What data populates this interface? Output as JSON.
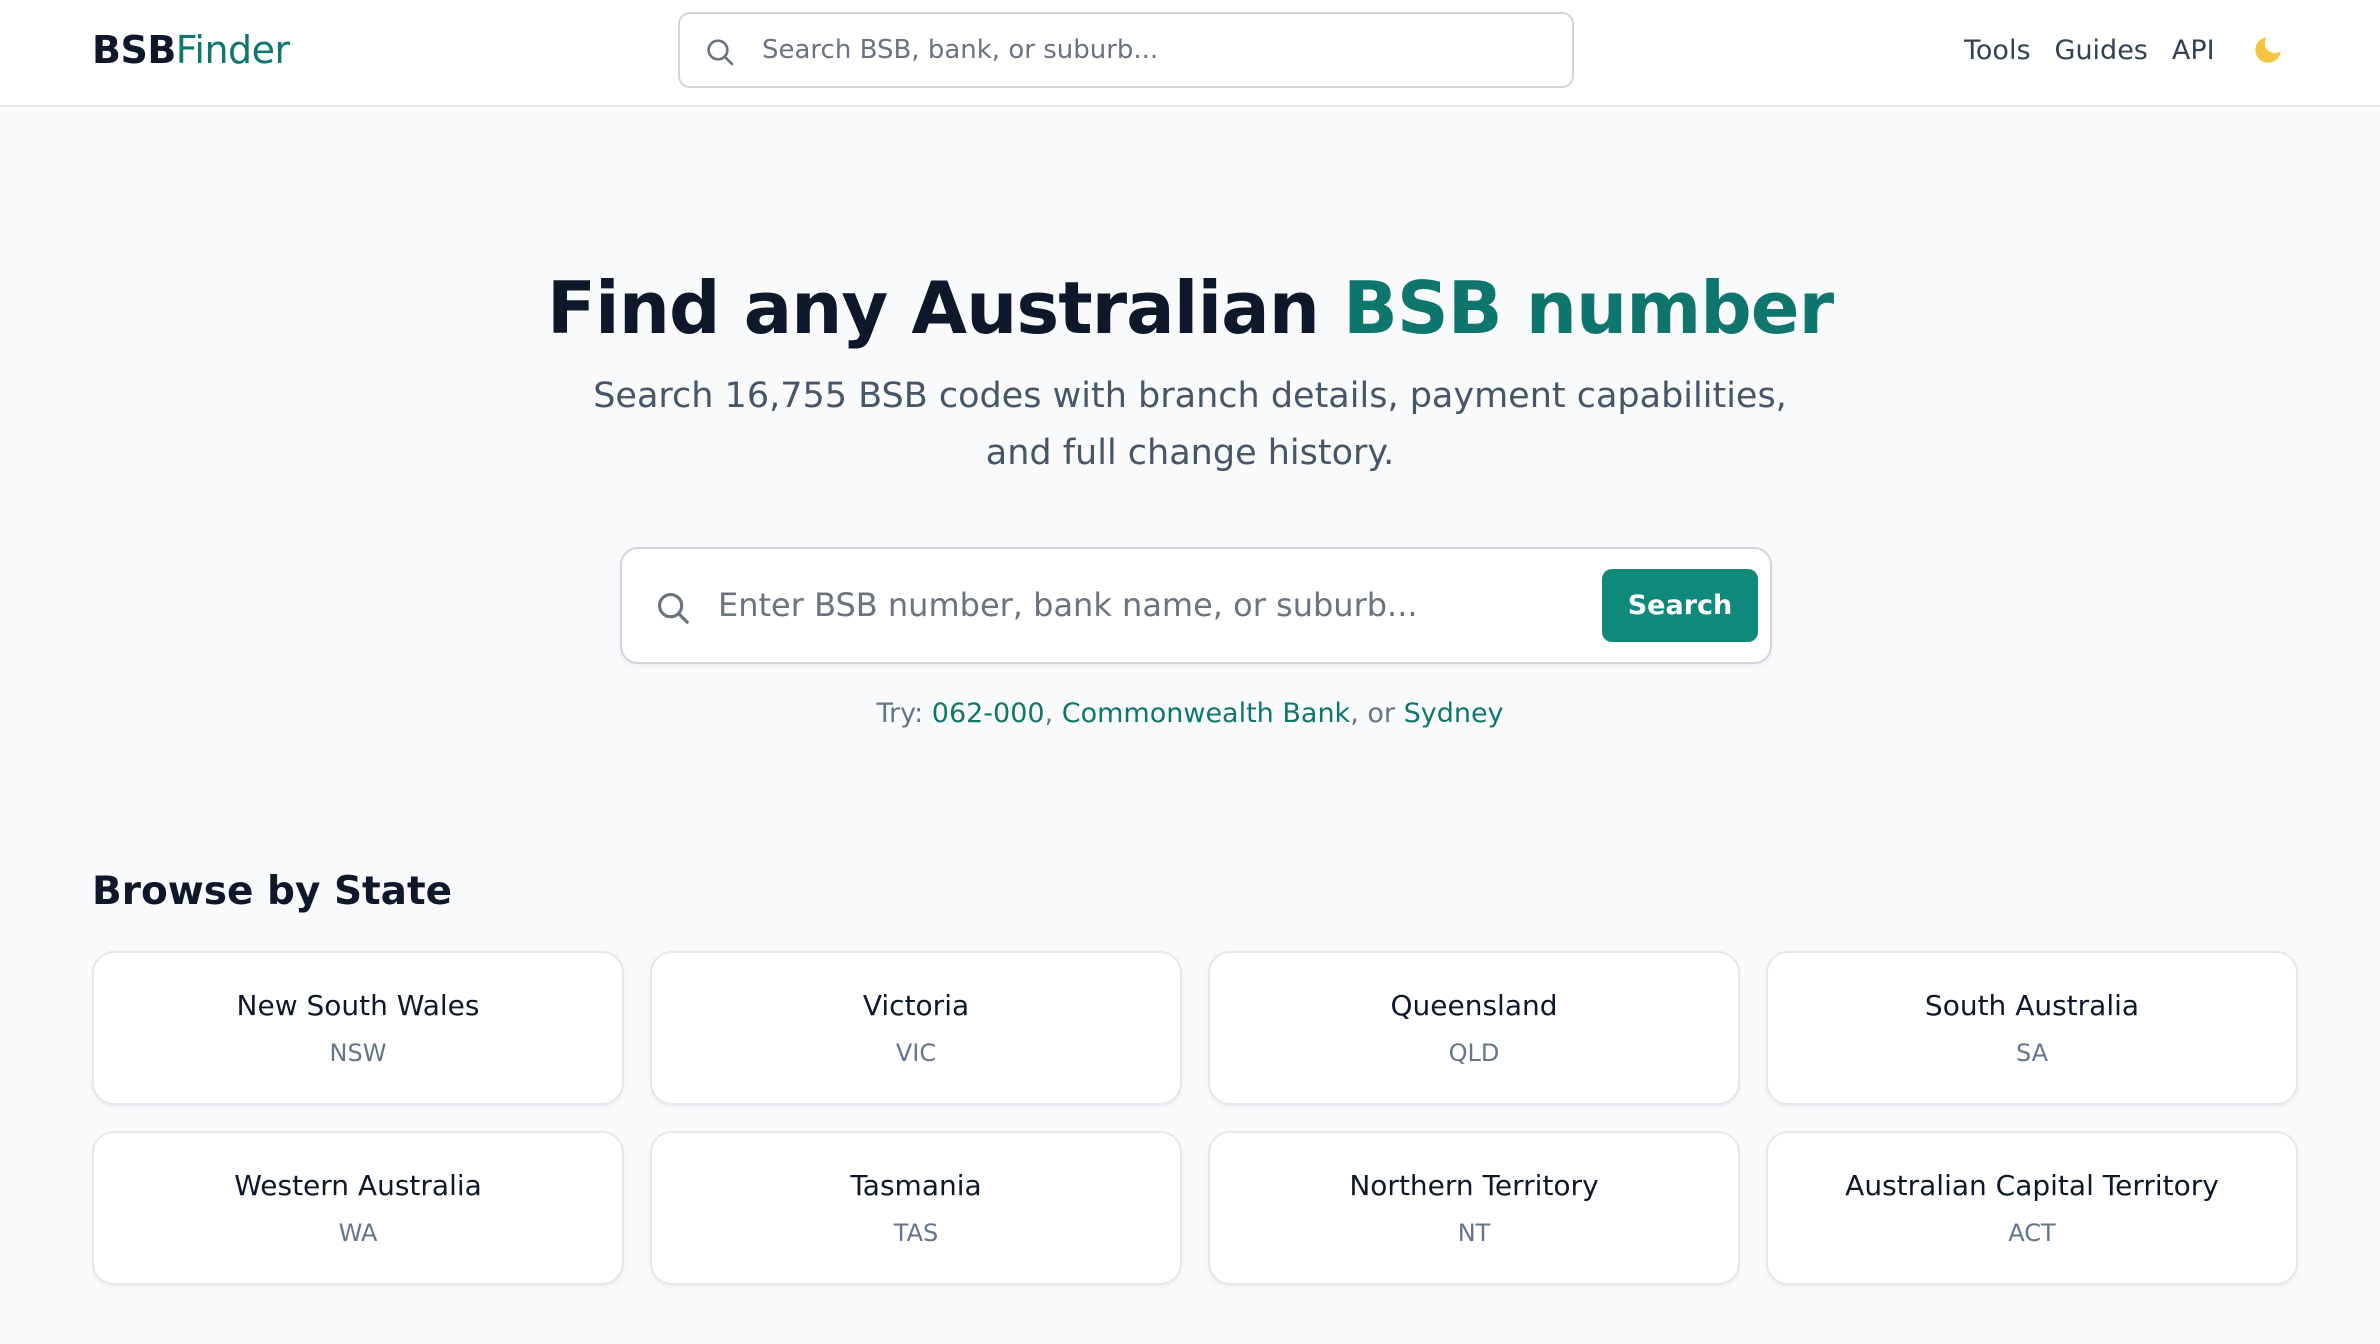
{
  "header": {
    "logo_bold": "BSB",
    "logo_light": "Finder",
    "search_placeholder": "Search BSB, bank, or suburb...",
    "nav": [
      {
        "label": "Tools"
      },
      {
        "label": "Guides"
      },
      {
        "label": "API"
      }
    ],
    "theme_toggle_icon": "moon-icon"
  },
  "hero": {
    "title_main": "Find any Australian ",
    "title_accent": "BSB number",
    "subtitle": "Search 16,755 BSB codes with branch details, payment capabilities, and full change history.",
    "search_placeholder": "Enter BSB number, bank name, or suburb...",
    "search_button": "Search",
    "try_prefix": "Try: ",
    "try_links": [
      "062-000",
      "Commonwealth Bank",
      "Sydney"
    ],
    "try_sep1": ", ",
    "try_sep2": ", or "
  },
  "browse": {
    "title": "Browse by State",
    "states": [
      {
        "name": "New South Wales",
        "abbr": "NSW"
      },
      {
        "name": "Victoria",
        "abbr": "VIC"
      },
      {
        "name": "Queensland",
        "abbr": "QLD"
      },
      {
        "name": "South Australia",
        "abbr": "SA"
      },
      {
        "name": "Western Australia",
        "abbr": "WA"
      },
      {
        "name": "Tasmania",
        "abbr": "TAS"
      },
      {
        "name": "Northern Territory",
        "abbr": "NT"
      },
      {
        "name": "Australian Capital Territory",
        "abbr": "ACT"
      }
    ]
  },
  "colors": {
    "accent": "#0f766e",
    "button": "#0f8a7a",
    "moon": "#f4c542"
  }
}
